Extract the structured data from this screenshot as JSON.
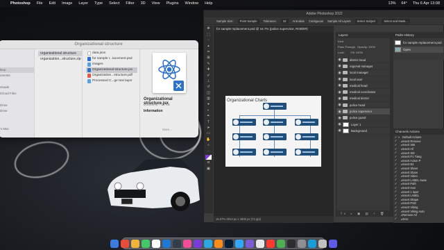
{
  "menubar": {
    "app": "Photoshop",
    "items": [
      "File",
      "Edit",
      "Image",
      "Layer",
      "Type",
      "Select",
      "Filter",
      "3D",
      "View",
      "Plugins",
      "Window",
      "Help"
    ],
    "battery": "13%",
    "temp": "64°",
    "datetime": "Thu 6 Apr 13:08"
  },
  "finder": {
    "title": "Organizational structure",
    "sidebar": [
      "",
      "",
      "",
      "ktop",
      "uments",
      "",
      "nloads",
      "iCloud Files",
      "",
      "Drive",
      "Drive",
      "",
      "",
      "'s Mac",
      "",
      "",
      "",
      "",
      ""
    ],
    "sidebar_selected_index": 3,
    "col1": [
      "organizational structure",
      "organization...structure.zip"
    ],
    "col2": [
      {
        "name": "data.json",
        "icon": "doc-icon",
        "color": "#ffffff"
      },
      {
        "name": "for sample r...lacement.psd",
        "icon": "psd-icon",
        "color": "#2d6fd6"
      },
      {
        "name": "images",
        "icon": "folder-icon",
        "color": "#5aa0e8"
      },
      {
        "name": "Organizational structure.jsx",
        "icon": "jsx-icon",
        "color": "#2f73c9"
      },
      {
        "name": "Organization...structure.pdf",
        "icon": "pdf-icon",
        "color": "#e25a4a"
      },
      {
        "name": "Processed C...ge text layer",
        "icon": "folder-icon",
        "color": "#5aa0e8"
      }
    ],
    "col2_selected_index": 3,
    "preview": {
      "name": "Organizational structure.jsx",
      "meta": "Document – 14 KB",
      "info": "Information",
      "more": "More..."
    }
  },
  "photoshop": {
    "title": "Adobe Photoshop 2022",
    "options": [
      "Sample Size:",
      "Point Sample",
      "Tolerance:",
      "32",
      "Anti-alias",
      "Contiguous",
      "Sample All Layers",
      "Select Subject",
      "Select and Mask..."
    ],
    "tab": "for sample replacement.psd @ 16.7% (police supervisor, RGB/8#)",
    "status": "16.67%   3913 px x 1800 px (72 ppi)",
    "chart_title": "Organizational Charts",
    "layers_tabs": "Layers",
    "layer_controls": [
      "Kind",
      "Pass Through",
      "Opacity: 100%",
      "Lock:",
      "Fill: 100%"
    ],
    "layers": [
      {
        "name": "district head",
        "type": "folder"
      },
      {
        "name": "regional manager",
        "type": "folder"
      },
      {
        "name": "local manager",
        "type": "folder"
      },
      {
        "name": "local user",
        "type": "folder"
      },
      {
        "name": "medical head",
        "type": "folder"
      },
      {
        "name": "medical coordinator",
        "type": "folder"
      },
      {
        "name": "medical doctor",
        "type": "folder"
      },
      {
        "name": "police head",
        "type": "folder"
      },
      {
        "name": "police supervisor",
        "type": "folder"
      },
      {
        "name": "police guard",
        "type": "folder"
      },
      {
        "name": "Layer 1",
        "type": "pixel"
      },
      {
        "name": "Background",
        "type": "pixel"
      }
    ],
    "selected_layer_index": 8,
    "layer_bottom": "fx ◐ ▣ ▤ + 🗑",
    "history_tabs": "Paths   History",
    "history": [
      "for sample replacement.psd",
      "Open"
    ],
    "actions_tabs": "Channels   Actions",
    "actions": [
      "Default Actions",
      "Insert Remove",
      "Insert 365",
      "Insert All",
      "Insert SM",
      "Insert P1 Tiang",
      "Insert Action P",
      "Insert B4",
      "Insert Sheet",
      "Insert Share",
      "Insert Video",
      "Insert LABEL Awas",
      "Insert Path",
      "Insert Hari",
      "Insert 1 layer",
      "Insert LABEL",
      "Insert Shape",
      "Insert PSD",
      "Insert Viking",
      "Insert Viking Auto",
      "Remove All",
      "Zero"
    ]
  },
  "dock_colors": [
    "#3b7be0",
    "#e84c3d",
    "#f0b43c",
    "#44c767",
    "#ffffff",
    "#1f78d1",
    "#333c4a",
    "#f04e98",
    "#7a3cd6",
    "#2ca7e0",
    "#ff8c1a",
    "#001e36",
    "#31a8ff",
    "#7b5cd6",
    "#e8e8e8",
    "#ff3b30",
    "#4caf50",
    "#2d2d2d",
    "#8e8e93",
    "#1b9bd8",
    "#c0c0c0",
    "#5e5ce6"
  ]
}
